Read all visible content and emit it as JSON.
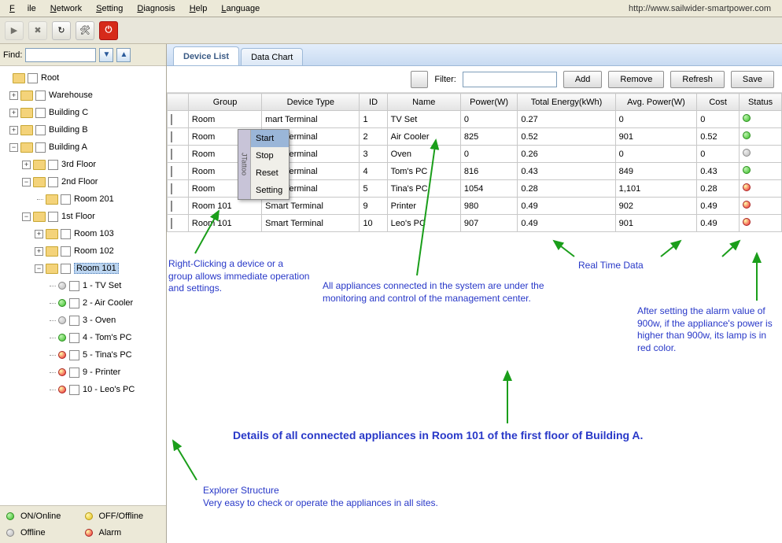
{
  "menu": {
    "file": "File",
    "network": "Network",
    "setting": "Setting",
    "diagnosis": "Diagnosis",
    "help": "Help",
    "language": "Language"
  },
  "url": "http://www.sailwider-smartpower.com",
  "find": {
    "label": "Find:"
  },
  "tree": {
    "root": "Root",
    "warehouse": "Warehouse",
    "bc": "Building C",
    "bb": "Building B",
    "ba": "Building A",
    "f3": "3rd Floor",
    "f2": "2nd Floor",
    "r201": "Room 201",
    "f1": "1st Floor",
    "r103": "Room 103",
    "r102": "Room 102",
    "r101": "Room 101",
    "d1": "1 - TV Set",
    "d2": "2 - Air Cooler",
    "d3": "3 - Oven",
    "d4": "4 - Tom's PC",
    "d5": "5 - Tina's PC",
    "d9": "9 - Printer",
    "d10": "10 - Leo's PC"
  },
  "legend": {
    "on": "ON/Online",
    "off": "OFF/Offline",
    "offline": "Offline",
    "alarm": "Alarm"
  },
  "tabs": {
    "list": "Device List",
    "chart": "Data Chart"
  },
  "filter": {
    "label": "Filter:",
    "add": "Add",
    "remove": "Remove",
    "refresh": "Refresh",
    "save": "Save"
  },
  "cols": {
    "group": "Group",
    "type": "Device Type",
    "id": "ID",
    "name": "Name",
    "power": "Power(W)",
    "total": "Total Energy(kWh)",
    "avg": "Avg. Power(W)",
    "cost": "Cost",
    "status": "Status"
  },
  "rows": [
    {
      "group": "Room",
      "type": "mart Terminal",
      "id": "1",
      "name": "TV Set",
      "power": "0",
      "total": "0.27",
      "avg": "0",
      "cost": "0",
      "status": "green"
    },
    {
      "group": "Room",
      "type": "mart Terminal",
      "id": "2",
      "name": "Air Cooler",
      "power": "825",
      "total": "0.52",
      "avg": "901",
      "cost": "0.52",
      "status": "green"
    },
    {
      "group": "Room",
      "type": "mart Terminal",
      "id": "3",
      "name": "Oven",
      "power": "0",
      "total": "0.26",
      "avg": "0",
      "cost": "0",
      "status": "gray"
    },
    {
      "group": "Room",
      "type": "mart Terminal",
      "id": "4",
      "name": "Tom's PC",
      "power": "816",
      "total": "0.43",
      "avg": "849",
      "cost": "0.43",
      "status": "green"
    },
    {
      "group": "Room",
      "type": "mart Terminal",
      "id": "5",
      "name": "Tina's PC",
      "power": "1054",
      "total": "0.28",
      "avg": "1,101",
      "cost": "0.28",
      "status": "red"
    },
    {
      "group": "Room 101",
      "type": "Smart Terminal",
      "id": "9",
      "name": "Printer",
      "power": "980",
      "total": "0.49",
      "avg": "902",
      "cost": "0.49",
      "status": "red"
    },
    {
      "group": "Room 101",
      "type": "Smart Terminal",
      "id": "10",
      "name": "Leo's PC",
      "power": "907",
      "total": "0.49",
      "avg": "901",
      "cost": "0.49",
      "status": "red"
    }
  ],
  "ctx": {
    "start": "Start",
    "stop": "Stop",
    "reset": "Reset",
    "setting": "Setting",
    "strip": "JTattoo"
  },
  "annot": {
    "a1": "Right-Clicking a device or a group allows immediate operation and settings.",
    "a2": "All appliances connected in the system are under the monitoring and control of the management center.",
    "a3": "Real Time Data",
    "a4": "After setting the alarm value of 900w, if the appliance's power is higher than 900w, its lamp is in red color.",
    "a5": "Details of all connected appliances in Room 101 of the first floor of Building A.",
    "a6": "Explorer Structure\nVery easy to check or operate the appliances in all sites."
  }
}
